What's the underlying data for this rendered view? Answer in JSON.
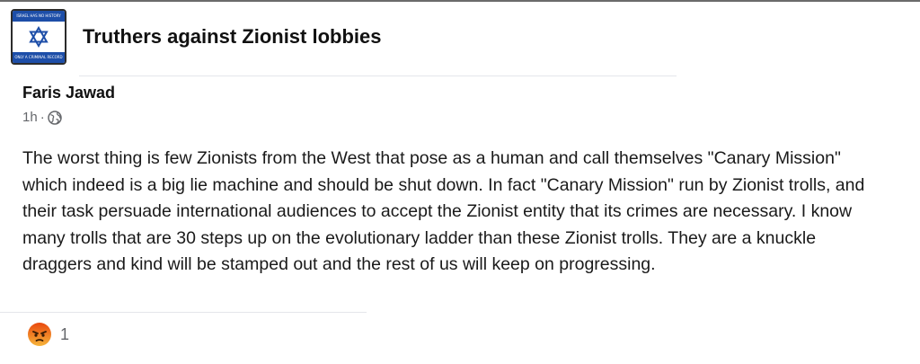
{
  "group": {
    "name": "Truthers against Zionist lobbies",
    "avatar_text_top": "ISRAEL HAS NO HISTORY",
    "avatar_text_bottom": "ONLY A CRIMINAL RECORD",
    "avatar_icon": "star-of-david",
    "avatar_color": "#1d4ea8"
  },
  "post": {
    "author": "Faris Jawad",
    "time": "1h",
    "separator": "·",
    "audience_icon": "globe-icon",
    "text": "The worst thing is few Zionists from the West that pose as a human and call themselves \"Canary Mission\" which indeed is a big lie machine and should be shut down. In fact \"Canary Mission\" run by Zionist trolls, and their task persuade international audiences to accept the Zionist entity that its crimes are necessary. I know many trolls that are 30 steps up on the evolutionary ladder than these Zionist trolls. They are a knuckle draggers and kind will be stamped out and the rest of us will keep on progressing."
  },
  "reactions": {
    "icon": "angry-icon",
    "count": "1"
  }
}
